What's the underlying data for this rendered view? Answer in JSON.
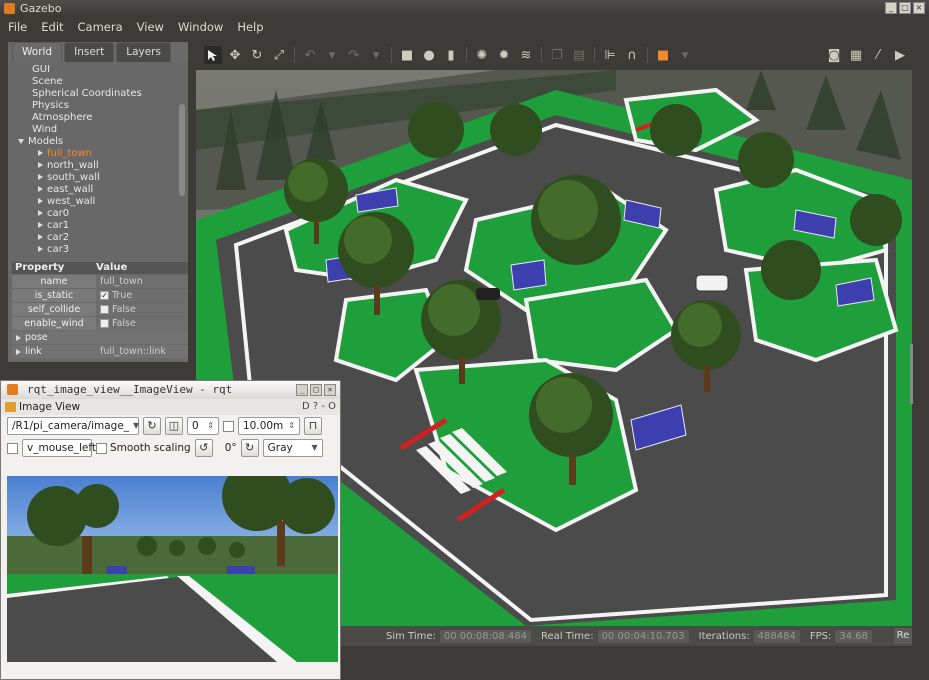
{
  "window": {
    "title": "Gazebo",
    "controls": [
      "_",
      "□",
      "×"
    ]
  },
  "menubar": [
    "File",
    "Edit",
    "Camera",
    "View",
    "Window",
    "Help"
  ],
  "left_panel": {
    "tabs": [
      "World",
      "Insert",
      "Layers"
    ],
    "tree": [
      {
        "label": "GUI",
        "indent": 1,
        "arrow": "none"
      },
      {
        "label": "Scene",
        "indent": 1,
        "arrow": "none"
      },
      {
        "label": "Spherical Coordinates",
        "indent": 1,
        "arrow": "none"
      },
      {
        "label": "Physics",
        "indent": 1,
        "arrow": "none"
      },
      {
        "label": "Atmosphere",
        "indent": 1,
        "arrow": "none"
      },
      {
        "label": "Wind",
        "indent": 1,
        "arrow": "none"
      },
      {
        "label": "Models",
        "indent": 0,
        "arrow": "down"
      },
      {
        "label": "full_town",
        "indent": 2,
        "arrow": "right",
        "selected": true
      },
      {
        "label": "north_wall",
        "indent": 2,
        "arrow": "right"
      },
      {
        "label": "south_wall",
        "indent": 2,
        "arrow": "right"
      },
      {
        "label": "east_wall",
        "indent": 2,
        "arrow": "right"
      },
      {
        "label": "west_wall",
        "indent": 2,
        "arrow": "right"
      },
      {
        "label": "car0",
        "indent": 2,
        "arrow": "right"
      },
      {
        "label": "car1",
        "indent": 2,
        "arrow": "right"
      },
      {
        "label": "car2",
        "indent": 2,
        "arrow": "right"
      },
      {
        "label": "car3",
        "indent": 2,
        "arrow": "right"
      }
    ],
    "properties": {
      "header": [
        "Property",
        "Value"
      ],
      "rows": [
        {
          "key": "name",
          "value": "full_town",
          "check": "none"
        },
        {
          "key": "is_static",
          "value": "True",
          "check": "checked"
        },
        {
          "key": "self_collide",
          "value": "False",
          "check": "unchecked"
        },
        {
          "key": "enable_wind",
          "value": "False",
          "check": "unchecked"
        }
      ],
      "expanders": [
        {
          "key": "pose",
          "value": ""
        },
        {
          "key": "link",
          "value": "full_town::link"
        }
      ]
    }
  },
  "toolbar": {
    "tools": [
      "select-arrow",
      "translate",
      "rotate",
      "scale",
      "undo",
      "undo-dropdown",
      "redo",
      "redo-dropdown",
      "box",
      "sphere",
      "cylinder",
      "point-light",
      "spot-light",
      "directional-light",
      "copy",
      "paste",
      "align",
      "snap",
      "orange-marker"
    ],
    "right_tools": [
      "screenshot",
      "log",
      "plot",
      "video"
    ]
  },
  "statusbar": {
    "sim_time_label": "Sim Time:",
    "sim_time": "00 00:08:08.484",
    "real_time_label": "Real Time:",
    "real_time": "00 00:04:10.703",
    "iterations_label": "Iterations:",
    "iterations": "488484",
    "fps_label": "FPS:",
    "fps": "34.68",
    "reset_label": "Re"
  },
  "rqt": {
    "title": "rqt_image_view__ImageView - rqt",
    "subtitle": "Image View",
    "subtitle_right": "D ? - O",
    "topic": "/R1/pi_camera/image_",
    "refresh_icon": "↻",
    "spin_value": "0",
    "distance": "10.00m",
    "mouse_label": "v_mouse_left",
    "smooth_label": "Smooth scaling",
    "rotate_value": "0°",
    "color_mode": "Gray"
  },
  "colors": {
    "grass": "#1f9e3c",
    "road": "#4b4b4b",
    "wall": "#7a7a72",
    "accent": "#f08a2a"
  }
}
